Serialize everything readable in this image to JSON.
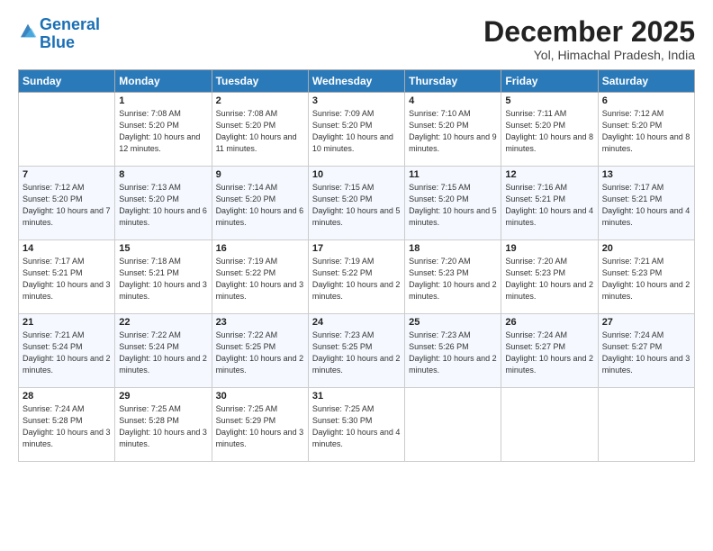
{
  "header": {
    "logo_line1": "General",
    "logo_line2": "Blue",
    "month": "December 2025",
    "location": "Yol, Himachal Pradesh, India"
  },
  "weekdays": [
    "Sunday",
    "Monday",
    "Tuesday",
    "Wednesday",
    "Thursday",
    "Friday",
    "Saturday"
  ],
  "weeks": [
    [
      {
        "day": "",
        "sunrise": "",
        "sunset": "",
        "daylight": ""
      },
      {
        "day": "1",
        "sunrise": "Sunrise: 7:08 AM",
        "sunset": "Sunset: 5:20 PM",
        "daylight": "Daylight: 10 hours and 12 minutes."
      },
      {
        "day": "2",
        "sunrise": "Sunrise: 7:08 AM",
        "sunset": "Sunset: 5:20 PM",
        "daylight": "Daylight: 10 hours and 11 minutes."
      },
      {
        "day": "3",
        "sunrise": "Sunrise: 7:09 AM",
        "sunset": "Sunset: 5:20 PM",
        "daylight": "Daylight: 10 hours and 10 minutes."
      },
      {
        "day": "4",
        "sunrise": "Sunrise: 7:10 AM",
        "sunset": "Sunset: 5:20 PM",
        "daylight": "Daylight: 10 hours and 9 minutes."
      },
      {
        "day": "5",
        "sunrise": "Sunrise: 7:11 AM",
        "sunset": "Sunset: 5:20 PM",
        "daylight": "Daylight: 10 hours and 8 minutes."
      },
      {
        "day": "6",
        "sunrise": "Sunrise: 7:12 AM",
        "sunset": "Sunset: 5:20 PM",
        "daylight": "Daylight: 10 hours and 8 minutes."
      }
    ],
    [
      {
        "day": "7",
        "sunrise": "Sunrise: 7:12 AM",
        "sunset": "Sunset: 5:20 PM",
        "daylight": "Daylight: 10 hours and 7 minutes."
      },
      {
        "day": "8",
        "sunrise": "Sunrise: 7:13 AM",
        "sunset": "Sunset: 5:20 PM",
        "daylight": "Daylight: 10 hours and 6 minutes."
      },
      {
        "day": "9",
        "sunrise": "Sunrise: 7:14 AM",
        "sunset": "Sunset: 5:20 PM",
        "daylight": "Daylight: 10 hours and 6 minutes."
      },
      {
        "day": "10",
        "sunrise": "Sunrise: 7:15 AM",
        "sunset": "Sunset: 5:20 PM",
        "daylight": "Daylight: 10 hours and 5 minutes."
      },
      {
        "day": "11",
        "sunrise": "Sunrise: 7:15 AM",
        "sunset": "Sunset: 5:20 PM",
        "daylight": "Daylight: 10 hours and 5 minutes."
      },
      {
        "day": "12",
        "sunrise": "Sunrise: 7:16 AM",
        "sunset": "Sunset: 5:21 PM",
        "daylight": "Daylight: 10 hours and 4 minutes."
      },
      {
        "day": "13",
        "sunrise": "Sunrise: 7:17 AM",
        "sunset": "Sunset: 5:21 PM",
        "daylight": "Daylight: 10 hours and 4 minutes."
      }
    ],
    [
      {
        "day": "14",
        "sunrise": "Sunrise: 7:17 AM",
        "sunset": "Sunset: 5:21 PM",
        "daylight": "Daylight: 10 hours and 3 minutes."
      },
      {
        "day": "15",
        "sunrise": "Sunrise: 7:18 AM",
        "sunset": "Sunset: 5:21 PM",
        "daylight": "Daylight: 10 hours and 3 minutes."
      },
      {
        "day": "16",
        "sunrise": "Sunrise: 7:19 AM",
        "sunset": "Sunset: 5:22 PM",
        "daylight": "Daylight: 10 hours and 3 minutes."
      },
      {
        "day": "17",
        "sunrise": "Sunrise: 7:19 AM",
        "sunset": "Sunset: 5:22 PM",
        "daylight": "Daylight: 10 hours and 2 minutes."
      },
      {
        "day": "18",
        "sunrise": "Sunrise: 7:20 AM",
        "sunset": "Sunset: 5:23 PM",
        "daylight": "Daylight: 10 hours and 2 minutes."
      },
      {
        "day": "19",
        "sunrise": "Sunrise: 7:20 AM",
        "sunset": "Sunset: 5:23 PM",
        "daylight": "Daylight: 10 hours and 2 minutes."
      },
      {
        "day": "20",
        "sunrise": "Sunrise: 7:21 AM",
        "sunset": "Sunset: 5:23 PM",
        "daylight": "Daylight: 10 hours and 2 minutes."
      }
    ],
    [
      {
        "day": "21",
        "sunrise": "Sunrise: 7:21 AM",
        "sunset": "Sunset: 5:24 PM",
        "daylight": "Daylight: 10 hours and 2 minutes."
      },
      {
        "day": "22",
        "sunrise": "Sunrise: 7:22 AM",
        "sunset": "Sunset: 5:24 PM",
        "daylight": "Daylight: 10 hours and 2 minutes."
      },
      {
        "day": "23",
        "sunrise": "Sunrise: 7:22 AM",
        "sunset": "Sunset: 5:25 PM",
        "daylight": "Daylight: 10 hours and 2 minutes."
      },
      {
        "day": "24",
        "sunrise": "Sunrise: 7:23 AM",
        "sunset": "Sunset: 5:25 PM",
        "daylight": "Daylight: 10 hours and 2 minutes."
      },
      {
        "day": "25",
        "sunrise": "Sunrise: 7:23 AM",
        "sunset": "Sunset: 5:26 PM",
        "daylight": "Daylight: 10 hours and 2 minutes."
      },
      {
        "day": "26",
        "sunrise": "Sunrise: 7:24 AM",
        "sunset": "Sunset: 5:27 PM",
        "daylight": "Daylight: 10 hours and 2 minutes."
      },
      {
        "day": "27",
        "sunrise": "Sunrise: 7:24 AM",
        "sunset": "Sunset: 5:27 PM",
        "daylight": "Daylight: 10 hours and 3 minutes."
      }
    ],
    [
      {
        "day": "28",
        "sunrise": "Sunrise: 7:24 AM",
        "sunset": "Sunset: 5:28 PM",
        "daylight": "Daylight: 10 hours and 3 minutes."
      },
      {
        "day": "29",
        "sunrise": "Sunrise: 7:25 AM",
        "sunset": "Sunset: 5:28 PM",
        "daylight": "Daylight: 10 hours and 3 minutes."
      },
      {
        "day": "30",
        "sunrise": "Sunrise: 7:25 AM",
        "sunset": "Sunset: 5:29 PM",
        "daylight": "Daylight: 10 hours and 3 minutes."
      },
      {
        "day": "31",
        "sunrise": "Sunrise: 7:25 AM",
        "sunset": "Sunset: 5:30 PM",
        "daylight": "Daylight: 10 hours and 4 minutes."
      },
      {
        "day": "",
        "sunrise": "",
        "sunset": "",
        "daylight": ""
      },
      {
        "day": "",
        "sunrise": "",
        "sunset": "",
        "daylight": ""
      },
      {
        "day": "",
        "sunrise": "",
        "sunset": "",
        "daylight": ""
      }
    ]
  ]
}
